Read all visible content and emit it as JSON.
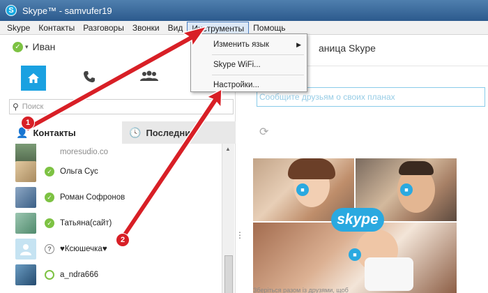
{
  "window": {
    "title": "Skype™ - samvufer19",
    "logo_letter": "S"
  },
  "menubar": [
    {
      "label": "Skype"
    },
    {
      "label": "Контакты"
    },
    {
      "label": "Разговоры"
    },
    {
      "label": "Звонки"
    },
    {
      "label": "Вид"
    },
    {
      "label": "Инструменты",
      "active": true
    },
    {
      "label": "Помощь"
    }
  ],
  "dropdown": {
    "items": [
      {
        "label": "Изменить язык",
        "submenu": true
      },
      {
        "label": "Skype WiFi..."
      },
      {
        "label": "Настройки..."
      }
    ]
  },
  "user": {
    "name": "Иван",
    "status": "online"
  },
  "search": {
    "placeholder": "Поиск"
  },
  "tabs": {
    "contacts": "Контакты",
    "recent": "Последние"
  },
  "contacts": [
    {
      "name": "moresudio.co",
      "status": "none",
      "grey": true
    },
    {
      "name": "Ольга Сус",
      "status": "online"
    },
    {
      "name": "Роман Софронов",
      "status": "online"
    },
    {
      "name": "Татьяна(сайт)",
      "status": "online"
    },
    {
      "name": "♥Ксюшечка♥",
      "status": "unknown"
    },
    {
      "name": "a_ndra666",
      "status": "offline"
    }
  ],
  "right": {
    "title": "аница Skype",
    "mood_placeholder": "Сообщите друзьям о своих планах",
    "promo_logo": "skype",
    "promo_caption": "Зберіться разом із друзями, щоб"
  },
  "annotations": {
    "badge1": "1",
    "badge2": "2"
  },
  "colors": {
    "accent": "#1aa1e1",
    "online": "#7dc243",
    "arrow": "#d81f26"
  }
}
